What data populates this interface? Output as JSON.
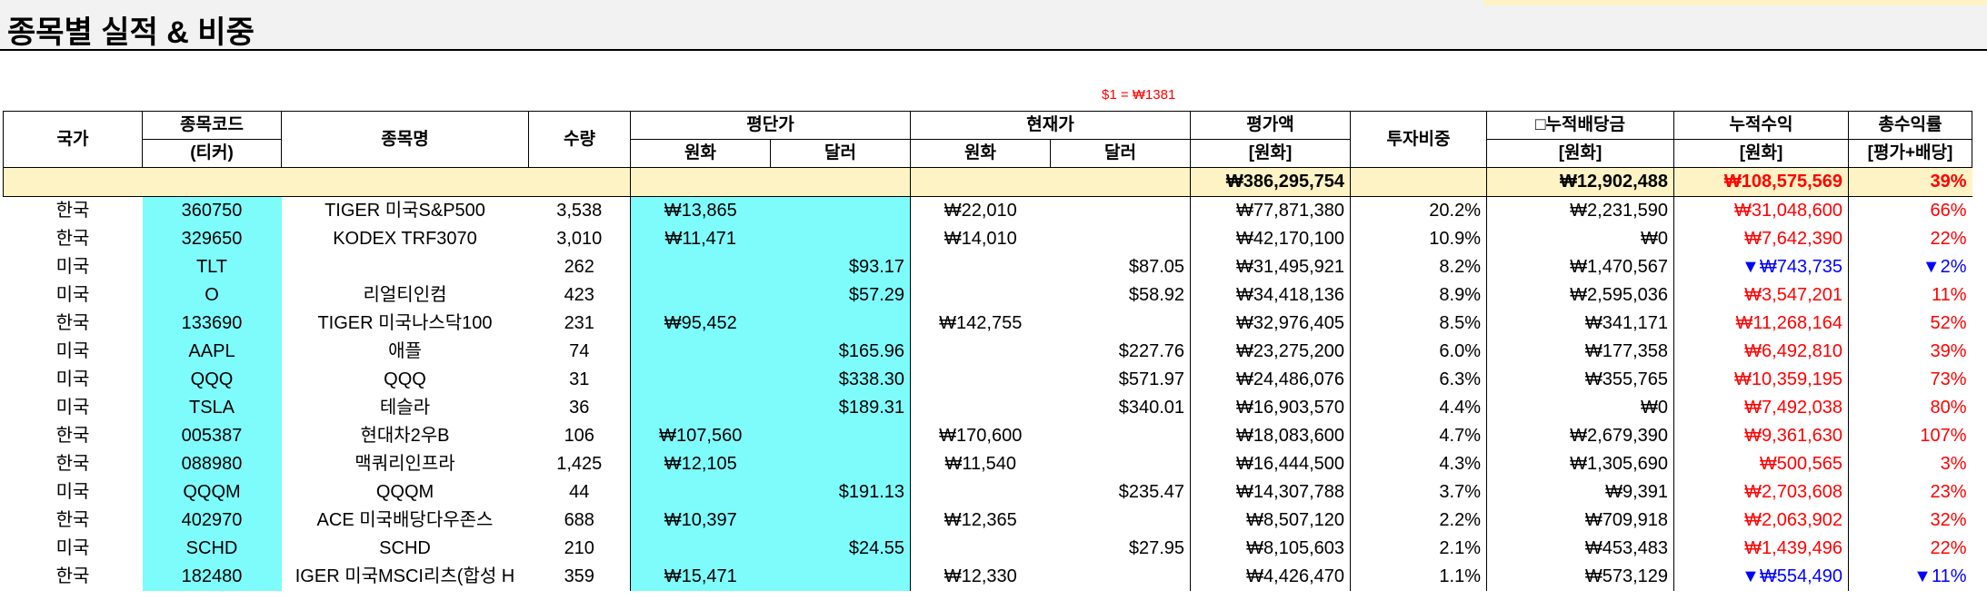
{
  "title": "종목별 실적 & 비중",
  "exchange_rate": "$1 = ₩1381",
  "headers": {
    "country": "국가",
    "code_line1": "종목코드",
    "code_line2": "(티커)",
    "name": "종목명",
    "qty": "수량",
    "avg_price": "평단가",
    "cur_price": "현재가",
    "krw": "원화",
    "usd": "달러",
    "eval_line1": "평가액",
    "eval_line2": "[원화]",
    "weight": "투자비중",
    "div_line1": "누적배당금",
    "div_line2": "[원화]",
    "profit_line1": "누적수익",
    "profit_line2": "[원화]",
    "ret_line1": "총수익률",
    "ret_line2": "[평가+배당]"
  },
  "totals": {
    "eval": "₩386,295,754",
    "dividend": "₩12,902,488",
    "profit": "₩108,575,569",
    "return": "39%"
  },
  "rows": [
    {
      "country": "한국",
      "code": "360750",
      "name": "TIGER 미국S&P500",
      "qty": "3,538",
      "avg_krw": "₩13,865",
      "avg_usd": "",
      "cur_krw": "₩22,010",
      "cur_usd": "",
      "eval": "₩77,871,380",
      "weight": "20.2%",
      "div": "₩2,231,590",
      "profit": "₩31,048,600",
      "ret": "66%",
      "profit_color": "red",
      "ret_color": "red"
    },
    {
      "country": "한국",
      "code": "329650",
      "name": "KODEX TRF3070",
      "qty": "3,010",
      "avg_krw": "₩11,471",
      "avg_usd": "",
      "cur_krw": "₩14,010",
      "cur_usd": "",
      "eval": "₩42,170,100",
      "weight": "10.9%",
      "div": "₩0",
      "profit": "₩7,642,390",
      "ret": "22%",
      "profit_color": "red",
      "ret_color": "red"
    },
    {
      "country": "미국",
      "code": "TLT",
      "name": "",
      "qty": "262",
      "avg_krw": "",
      "avg_usd": "$93.17",
      "cur_krw": "",
      "cur_usd": "$87.05",
      "eval": "₩31,495,921",
      "weight": "8.2%",
      "div": "₩1,470,567",
      "profit": "▼₩743,735",
      "ret": "▼2%",
      "profit_color": "blue",
      "ret_color": "blue"
    },
    {
      "country": "미국",
      "code": "O",
      "name": "리얼티인컴",
      "qty": "423",
      "avg_krw": "",
      "avg_usd": "$57.29",
      "cur_krw": "",
      "cur_usd": "$58.92",
      "eval": "₩34,418,136",
      "weight": "8.9%",
      "div": "₩2,595,036",
      "profit": "₩3,547,201",
      "ret": "11%",
      "profit_color": "red",
      "ret_color": "red"
    },
    {
      "country": "한국",
      "code": "133690",
      "name": "TIGER 미국나스닥100",
      "qty": "231",
      "avg_krw": "₩95,452",
      "avg_usd": "",
      "cur_krw": "₩142,755",
      "cur_usd": "",
      "eval": "₩32,976,405",
      "weight": "8.5%",
      "div": "₩341,171",
      "profit": "₩11,268,164",
      "ret": "52%",
      "profit_color": "red",
      "ret_color": "red"
    },
    {
      "country": "미국",
      "code": "AAPL",
      "name": "애플",
      "qty": "74",
      "avg_krw": "",
      "avg_usd": "$165.96",
      "cur_krw": "",
      "cur_usd": "$227.76",
      "eval": "₩23,275,200",
      "weight": "6.0%",
      "div": "₩177,358",
      "profit": "₩6,492,810",
      "ret": "39%",
      "profit_color": "red",
      "ret_color": "red"
    },
    {
      "country": "미국",
      "code": "QQQ",
      "name": "QQQ",
      "qty": "31",
      "avg_krw": "",
      "avg_usd": "$338.30",
      "cur_krw": "",
      "cur_usd": "$571.97",
      "eval": "₩24,486,076",
      "weight": "6.3%",
      "div": "₩355,765",
      "profit": "₩10,359,195",
      "ret": "73%",
      "profit_color": "red",
      "ret_color": "red"
    },
    {
      "country": "미국",
      "code": "TSLA",
      "name": "테슬라",
      "qty": "36",
      "avg_krw": "",
      "avg_usd": "$189.31",
      "cur_krw": "",
      "cur_usd": "$340.01",
      "eval": "₩16,903,570",
      "weight": "4.4%",
      "div": "₩0",
      "profit": "₩7,492,038",
      "ret": "80%",
      "profit_color": "red",
      "ret_color": "red"
    },
    {
      "country": "한국",
      "code": "005387",
      "name": "현대차2우B",
      "qty": "106",
      "avg_krw": "₩107,560",
      "avg_usd": "",
      "cur_krw": "₩170,600",
      "cur_usd": "",
      "eval": "₩18,083,600",
      "weight": "4.7%",
      "div": "₩2,679,390",
      "profit": "₩9,361,630",
      "ret": "107%",
      "profit_color": "red",
      "ret_color": "red"
    },
    {
      "country": "한국",
      "code": "088980",
      "name": "맥쿼리인프라",
      "qty": "1,425",
      "avg_krw": "₩12,105",
      "avg_usd": "",
      "cur_krw": "₩11,540",
      "cur_usd": "",
      "eval": "₩16,444,500",
      "weight": "4.3%",
      "div": "₩1,305,690",
      "profit": "₩500,565",
      "ret": "3%",
      "profit_color": "red",
      "ret_color": "red"
    },
    {
      "country": "미국",
      "code": "QQQM",
      "name": "QQQM",
      "qty": "44",
      "avg_krw": "",
      "avg_usd": "$191.13",
      "cur_krw": "",
      "cur_usd": "$235.47",
      "eval": "₩14,307,788",
      "weight": "3.7%",
      "div": "₩9,391",
      "profit": "₩2,703,608",
      "ret": "23%",
      "profit_color": "red",
      "ret_color": "red"
    },
    {
      "country": "한국",
      "code": "402970",
      "name": "ACE 미국배당다우존스",
      "qty": "688",
      "avg_krw": "₩10,397",
      "avg_usd": "",
      "cur_krw": "₩12,365",
      "cur_usd": "",
      "eval": "₩8,507,120",
      "weight": "2.2%",
      "div": "₩709,918",
      "profit": "₩2,063,902",
      "ret": "32%",
      "profit_color": "red",
      "ret_color": "red"
    },
    {
      "country": "미국",
      "code": "SCHD",
      "name": "SCHD",
      "qty": "210",
      "avg_krw": "",
      "avg_usd": "$24.55",
      "cur_krw": "",
      "cur_usd": "$27.95",
      "eval": "₩8,105,603",
      "weight": "2.1%",
      "div": "₩453,483",
      "profit": "₩1,439,496",
      "ret": "22%",
      "profit_color": "red",
      "ret_color": "red"
    },
    {
      "country": "한국",
      "code": "182480",
      "name": "IGER 미국MSCI리츠(합성 H",
      "qty": "359",
      "avg_krw": "₩15,471",
      "avg_usd": "",
      "cur_krw": "₩12,330",
      "cur_usd": "",
      "eval": "₩4,426,470",
      "weight": "1.1%",
      "div": "₩573,129",
      "profit": "▼₩554,490",
      "ret": "▼11%",
      "profit_color": "blue",
      "ret_color": "blue"
    }
  ]
}
